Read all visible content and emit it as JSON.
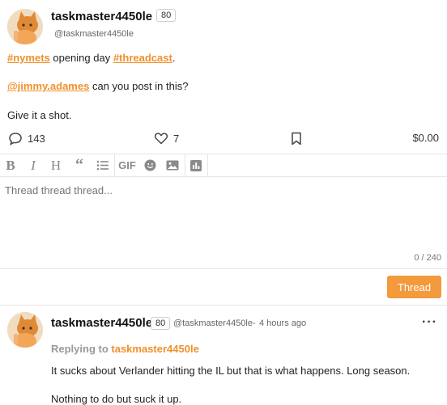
{
  "post": {
    "username": "taskmaster4450le",
    "reputation": "80",
    "handle": "@taskmaster4450le",
    "line1": {
      "tag1": "#nymets",
      "middle": " opening day ",
      "tag2": "#threadcast",
      "end": "."
    },
    "line2": {
      "mention": "@jimmy.adames",
      "rest": " can you post in this?"
    },
    "line3": "Give it a shot.",
    "comments": "143",
    "likes": "7",
    "payout": "$0.00"
  },
  "editor": {
    "toolbar": [
      "bold-icon",
      "italic-icon",
      "heading-icon",
      "quote-icon",
      "list-icon",
      "gif-icon",
      "emoji-icon",
      "image-icon",
      "chart-icon"
    ],
    "gif_label": "GIF",
    "placeholder": "Thread thread thread...",
    "counter": "0 / 240",
    "submit_label": "Thread"
  },
  "reply": {
    "username": "taskmaster4450le",
    "reputation": "80",
    "handle": "@taskmaster4450le",
    "time": "4 hours ago",
    "replying_prefix": "Replying to ",
    "replying_to": "taskmaster4450le",
    "line1": "It sucks about Verlander hitting the IL but that is what happens. Long season.",
    "line2": "Nothing to do but suck it up."
  },
  "colors": {
    "accent": "#f0902a",
    "button": "#f39a3d"
  }
}
